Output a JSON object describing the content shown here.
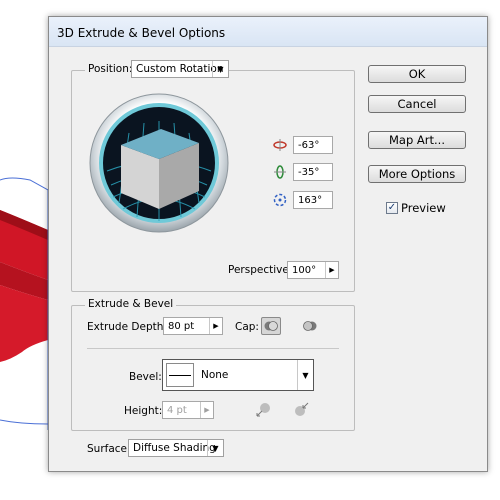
{
  "dialog": {
    "title": "3D Extrude & Bevel Options"
  },
  "position": {
    "label": "Position:",
    "value": "Custom Rotation"
  },
  "rotation": {
    "x_angle": "-63°",
    "y_angle": "-35°",
    "z_angle": "163°"
  },
  "perspective": {
    "label": "Perspective:",
    "value": "100°"
  },
  "buttons": {
    "ok": "OK",
    "cancel": "Cancel",
    "map_art": "Map Art...",
    "more_options": "More Options"
  },
  "preview": {
    "label": "Preview",
    "checked": true
  },
  "extrude_bevel": {
    "legend": "Extrude & Bevel",
    "depth_label": "Extrude Depth:",
    "depth_value": "80 pt",
    "cap_label": "Cap:",
    "bevel_label": "Bevel:",
    "bevel_value": "None",
    "height_label": "Height:",
    "height_value": "4 pt"
  },
  "surface": {
    "label": "Surface:",
    "value": "Diffuse Shading"
  },
  "colors": {
    "cube_top": "#6fb0c6",
    "cube_left": "#d4d4d4",
    "cube_right": "#a9a9a9",
    "track_ring": "#6fc9d8",
    "artwork_red": "#d01626"
  },
  "icons": {
    "rotate_x": "rotate-x-icon",
    "rotate_y": "rotate-y-icon",
    "rotate_z": "rotate-z-icon",
    "cap_on": "cap-on-icon",
    "cap_off": "cap-off-icon",
    "bevel_out": "bevel-out-icon",
    "bevel_in": "bevel-in-icon"
  }
}
